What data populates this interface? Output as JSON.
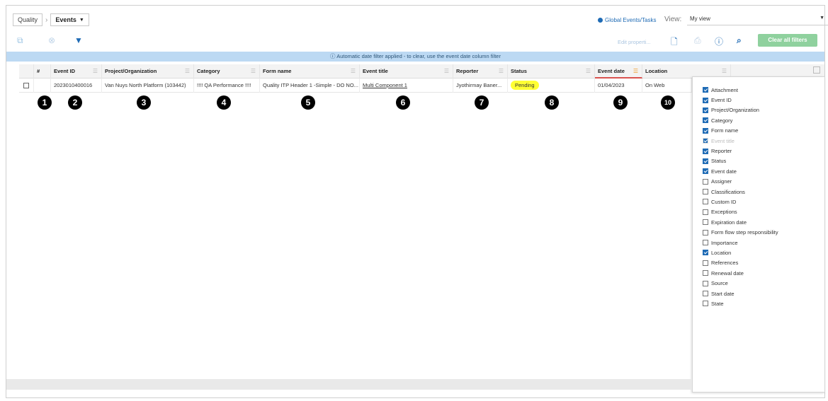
{
  "breadcrumb": {
    "root": "Quality",
    "current": "Events"
  },
  "header": {
    "global_link": "Global Events/Tasks",
    "view_label": "View:",
    "view_value": "My view"
  },
  "toolbar": {
    "edit_properties": "Edit properti...",
    "clear_filters": "Clear all filters"
  },
  "banner": {
    "text": "Automatic date filter applied - to clear, use the event date column filter"
  },
  "columns": [
    {
      "label": "#"
    },
    {
      "label": "Event ID"
    },
    {
      "label": "Project/Organization"
    },
    {
      "label": "Category"
    },
    {
      "label": "Form name"
    },
    {
      "label": "Event title"
    },
    {
      "label": "Reporter"
    },
    {
      "label": "Status"
    },
    {
      "label": "Event date"
    },
    {
      "label": "Location"
    }
  ],
  "row": {
    "event_id": "2023010400016",
    "project": "Van Nuys North Platform (103442)",
    "category": "!!!! QA Performance !!!!",
    "form_name": "Quality ITP Header 1 -Simple - DO NO...",
    "event_title": "Multi Component 1",
    "reporter": "Jyothirmay Baner...",
    "status": "Pending",
    "event_date": "01/04/2023",
    "location": "On Web"
  },
  "badges": [
    "1",
    "2",
    "3",
    "4",
    "5",
    "6",
    "7",
    "8",
    "9",
    "10"
  ],
  "column_chooser": [
    {
      "label": "Attachment",
      "checked": true
    },
    {
      "label": "Event ID",
      "checked": true
    },
    {
      "label": "Project/Organization",
      "checked": true
    },
    {
      "label": "Category",
      "checked": true
    },
    {
      "label": "Form name",
      "checked": true
    },
    {
      "label": "Event title",
      "checked": true,
      "disabled": true
    },
    {
      "label": "Reporter",
      "checked": true
    },
    {
      "label": "Status",
      "checked": true
    },
    {
      "label": "Event date",
      "checked": true
    },
    {
      "label": "Assigner",
      "checked": false
    },
    {
      "label": "Classifications",
      "checked": false
    },
    {
      "label": "Custom ID",
      "checked": false
    },
    {
      "label": "Exceptions",
      "checked": false
    },
    {
      "label": "Expiration date",
      "checked": false
    },
    {
      "label": "Form flow step responsibility",
      "checked": false
    },
    {
      "label": "Importance",
      "checked": false
    },
    {
      "label": "Location",
      "checked": true
    },
    {
      "label": "References",
      "checked": false
    },
    {
      "label": "Renewal date",
      "checked": false
    },
    {
      "label": "Source",
      "checked": false
    },
    {
      "label": "Start date",
      "checked": false
    },
    {
      "label": "State",
      "checked": false
    }
  ],
  "colors": {
    "accent": "#1f6bb5",
    "status_pending": "#ffff33",
    "clear_button": "#8fd19e",
    "banner": "#bcd9f3"
  }
}
